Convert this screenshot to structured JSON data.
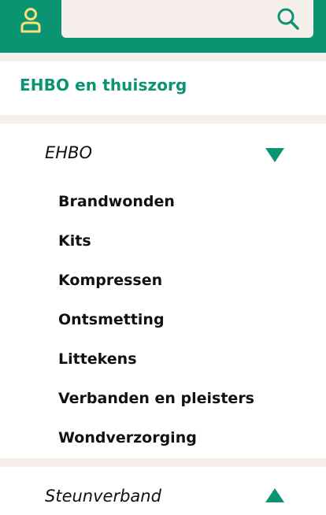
{
  "header": {
    "account_icon": "user-icon",
    "search": {
      "placeholder": "",
      "value": "",
      "icon": "search-icon"
    },
    "accent_color": "#0b9472",
    "search_bg_color": "#f6eeeb"
  },
  "category": {
    "title": "EHBO en thuiszorg"
  },
  "sections": [
    {
      "label": "EHBO",
      "expanded_icon": "triangle-down-icon",
      "items": [
        "Brandwonden",
        "Kits",
        "Kompressen",
        "Ontsmetting",
        "Littekens",
        "Verbanden en pleisters",
        "Wondverzorging"
      ]
    },
    {
      "label": "Steunverband",
      "collapsed_icon": "triangle-up-icon"
    }
  ]
}
